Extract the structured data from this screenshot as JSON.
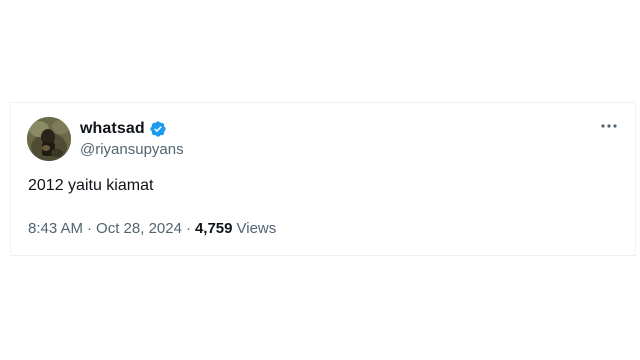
{
  "tweet": {
    "author": {
      "display_name": "whatsad",
      "handle": "@riyansupyans",
      "verified": true
    },
    "text": "2012 yaitu kiamat",
    "time": "8:43 AM",
    "separator": "·",
    "date": "Oct 28, 2024",
    "views_count": "4,759",
    "views_label": "Views"
  },
  "icons": {
    "verified": "verified-badge-icon",
    "more": "more-options-icon"
  },
  "colors": {
    "verified_blue": "#1d9bf0",
    "text_primary": "#0f1419",
    "text_secondary": "#536471"
  }
}
